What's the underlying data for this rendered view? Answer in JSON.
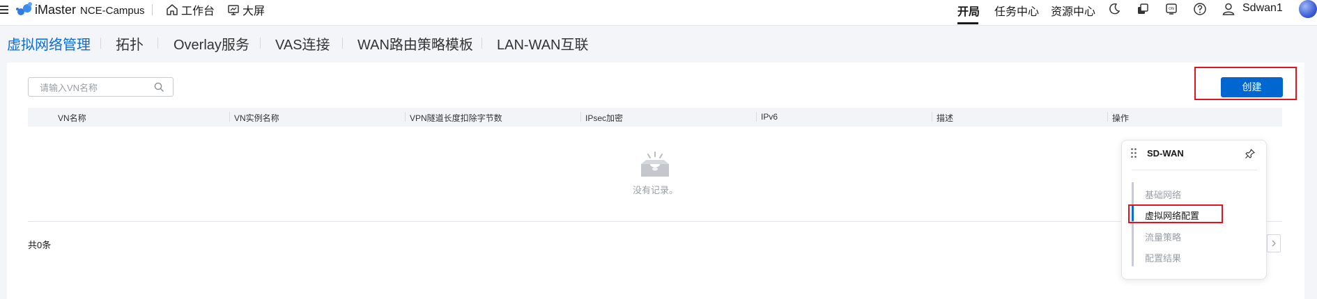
{
  "header": {
    "brand_name": "iMaster",
    "brand_product": "NCE-Campus",
    "nav": [
      {
        "label": "工作台",
        "icon": "home-icon"
      },
      {
        "label": "大屏",
        "icon": "monitor-icon"
      }
    ],
    "right_tabs": [
      {
        "label": "开局",
        "active": true
      },
      {
        "label": "任务中心",
        "active": false
      },
      {
        "label": "资源中心",
        "active": false
      }
    ],
    "icons": [
      "moon-icon",
      "copy-icon",
      "clipboard-icon",
      "help-icon",
      "user-icon"
    ],
    "username": "Sdwan1"
  },
  "subnav": {
    "items": [
      "虚拟网络管理",
      "拓扑",
      "Overlay服务",
      "VAS连接",
      "WAN路由策略模板",
      "LAN-WAN互联"
    ],
    "active_index": 0
  },
  "search": {
    "placeholder": "请输入VN名称",
    "value": ""
  },
  "toolbar": {
    "create_label": "创建"
  },
  "table": {
    "columns": [
      "VN名称",
      "VN实例名称",
      "VPN隧道长度扣除字节数",
      "IPsec加密",
      "IPv6",
      "描述",
      "操作"
    ],
    "rows": [],
    "empty_text": "没有记录。"
  },
  "pagination": {
    "total_text": "共0条"
  },
  "sdwan_panel": {
    "title": "SD-WAN",
    "steps": [
      "基础网络",
      "虚拟网络配置",
      "流量策略",
      "配置结果"
    ],
    "active_step": 1
  },
  "colors": {
    "accent": "#0a6cd8",
    "button": "#0067d1",
    "highlight_box": "#e0141e"
  }
}
